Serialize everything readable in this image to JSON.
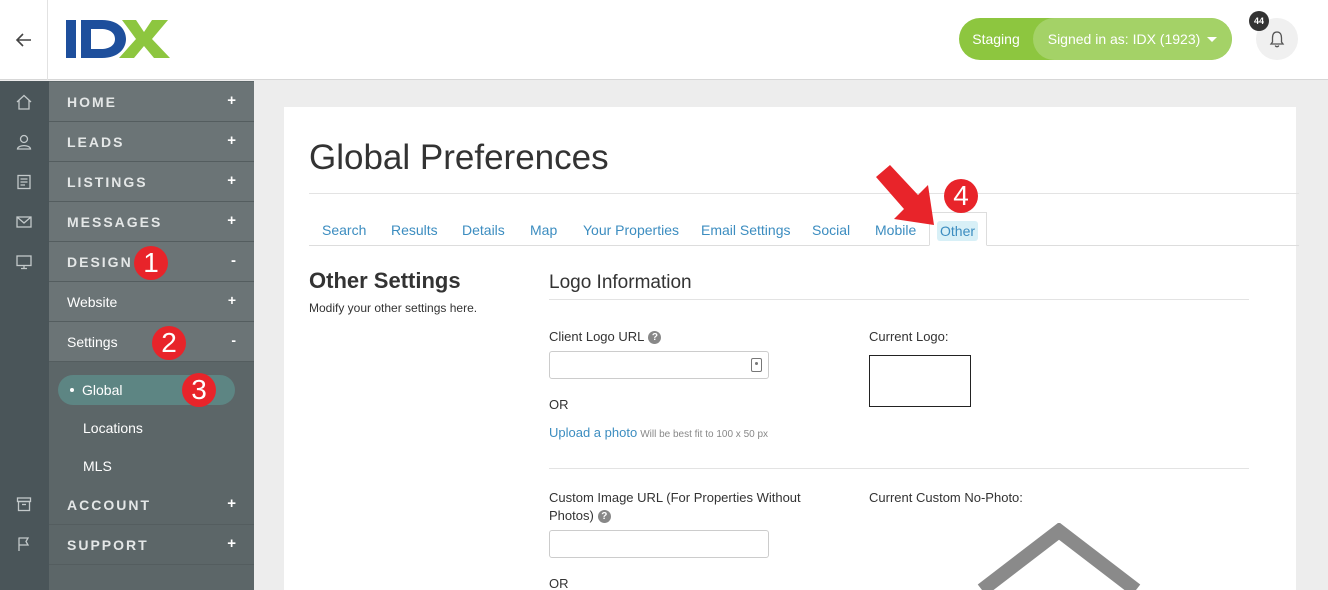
{
  "header": {
    "back_label": "←",
    "logo_text": "IDX",
    "environment": "Staging",
    "signed_in": "Signed in as: IDX (1923)",
    "notification_count": "44"
  },
  "rail_icons": [
    "home-icon",
    "user-icon",
    "listings-icon",
    "mail-icon",
    "monitor-icon",
    "archive-icon",
    "flag-icon"
  ],
  "menu": {
    "home": "HOME",
    "leads": "LEADS",
    "listings": "LISTINGS",
    "messages": "MESSAGES",
    "design": "DESIGN",
    "website": "Website",
    "settings": "Settings",
    "global": "Global",
    "locations": "Locations",
    "mls": "MLS",
    "account": "ACCOUNT",
    "support": "SUPPORT",
    "expand": "+",
    "collapse": "-"
  },
  "markers": [
    "1",
    "2",
    "3",
    "4"
  ],
  "page": {
    "title": "Global Preferences",
    "tabs": [
      "Search",
      "Results",
      "Details",
      "Map",
      "Your Properties",
      "Email Settings",
      "Social",
      "Mobile",
      "Other"
    ],
    "active_tab": "Other",
    "section_title": "Other Settings",
    "section_desc": "Modify your other settings here.",
    "group_title": "Logo Information",
    "client_logo_label": "Client Logo URL",
    "client_logo_value": "",
    "or_1": "OR",
    "upload_link": "Upload a photo",
    "upload_hint": "Will be best fit to 100 x 50 px",
    "current_logo_label": "Current Logo:",
    "custom_image_label": "Custom Image URL (For Properties Without Photos)",
    "custom_image_value": "",
    "current_nophoto_label": "Current Custom No-Photo:",
    "or_2": "OR",
    "help_glyph": "?"
  },
  "colors": {
    "accent_green": "#8dc63f",
    "link_blue": "#3c8dc0",
    "marker_red": "#e8242a",
    "sidebar": "#6b7476"
  }
}
